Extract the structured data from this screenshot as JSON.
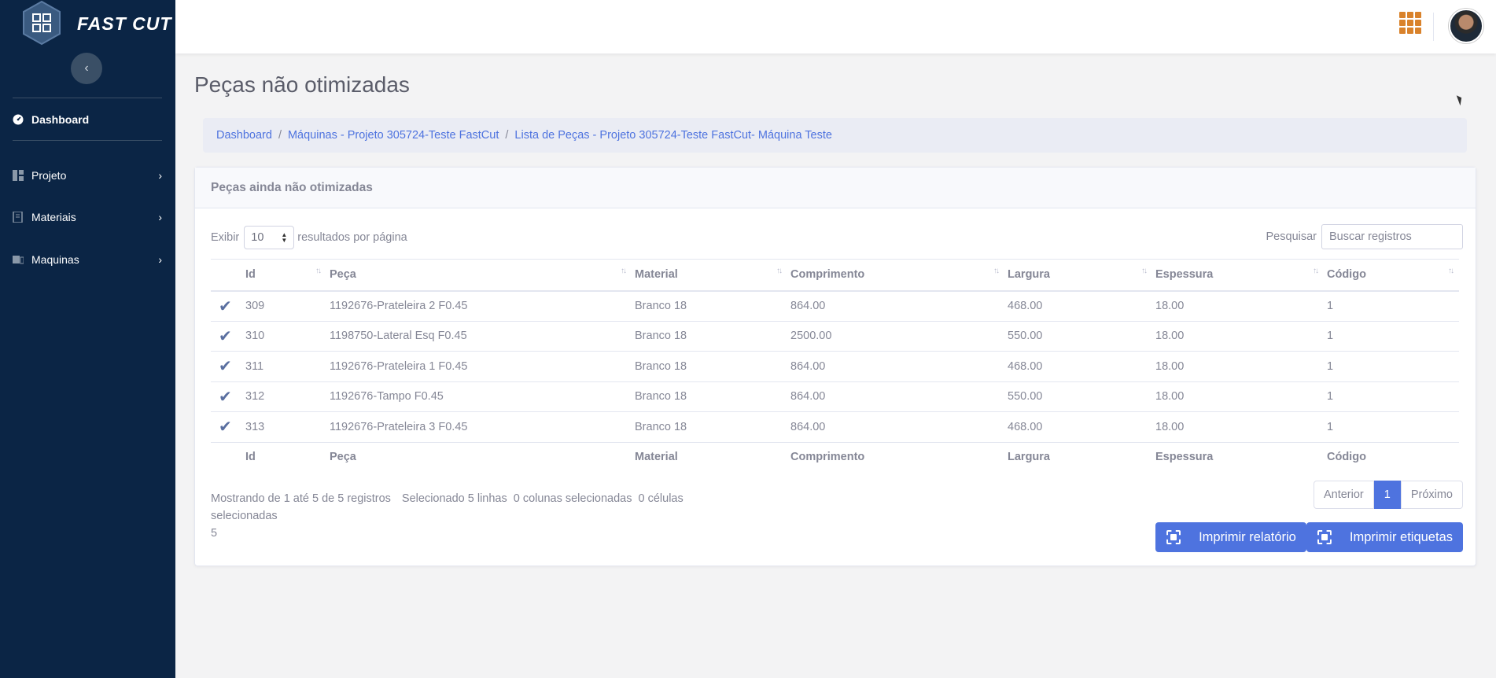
{
  "brand": {
    "name": "FAST CUT"
  },
  "sidebar": {
    "items": [
      {
        "label": "Dashboard",
        "icon": "dashboard-icon",
        "active": true
      },
      {
        "label": "Projeto",
        "icon": "layout-icon"
      },
      {
        "label": "Materiais",
        "icon": "book-icon"
      },
      {
        "label": "Maquinas",
        "icon": "machine-icon"
      }
    ]
  },
  "page": {
    "title": "Peças não otimizadas"
  },
  "breadcrumb": [
    "Dashboard",
    "Máquinas - Projeto 305724-Teste FastCut",
    "Lista de Peças - Projeto 305724-Teste FastCut- Máquina Teste"
  ],
  "card": {
    "title": "Peças ainda não otimizadas",
    "length_prefix": "Exibir",
    "length_value": "10",
    "length_suffix": "resultados por página",
    "search_label": "Pesquisar",
    "search_placeholder": "Buscar registros"
  },
  "table": {
    "headers": [
      "Id",
      "Peça",
      "Material",
      "Comprimento",
      "Largura",
      "Espessura",
      "Código"
    ],
    "rows": [
      [
        "309",
        "1192676-Prateleira 2 F0.45",
        "Branco 18",
        "864.00",
        "468.00",
        "18.00",
        "1"
      ],
      [
        "310",
        "1198750-Lateral Esq F0.45",
        "Branco 18",
        "2500.00",
        "550.00",
        "18.00",
        "1"
      ],
      [
        "311",
        "1192676-Prateleira 1 F0.45",
        "Branco 18",
        "864.00",
        "468.00",
        "18.00",
        "1"
      ],
      [
        "312",
        "1192676-Tampo F0.45",
        "Branco 18",
        "864.00",
        "550.00",
        "18.00",
        "1"
      ],
      [
        "313",
        "1192676-Prateleira 3 F0.45",
        "Branco 18",
        "864.00",
        "468.00",
        "18.00",
        "1"
      ]
    ],
    "check_mark": "✔"
  },
  "info": {
    "showing": "Mostrando de 1 até 5 de 5 registros",
    "selected_rows": "Selecionado 5 linhas",
    "selected_cols": "0 colunas selecionadas",
    "selected_cells": "0 células selecionadas",
    "count": "5"
  },
  "pagination": {
    "prev": "Anterior",
    "page": "1",
    "next": "Próximo"
  },
  "buttons": {
    "report": "Imprimir relatório",
    "labels": "Imprimir etiquetas"
  },
  "colors": {
    "sidebar": "#0b2545",
    "accent": "#4e73df",
    "apps": "#d9822b"
  }
}
